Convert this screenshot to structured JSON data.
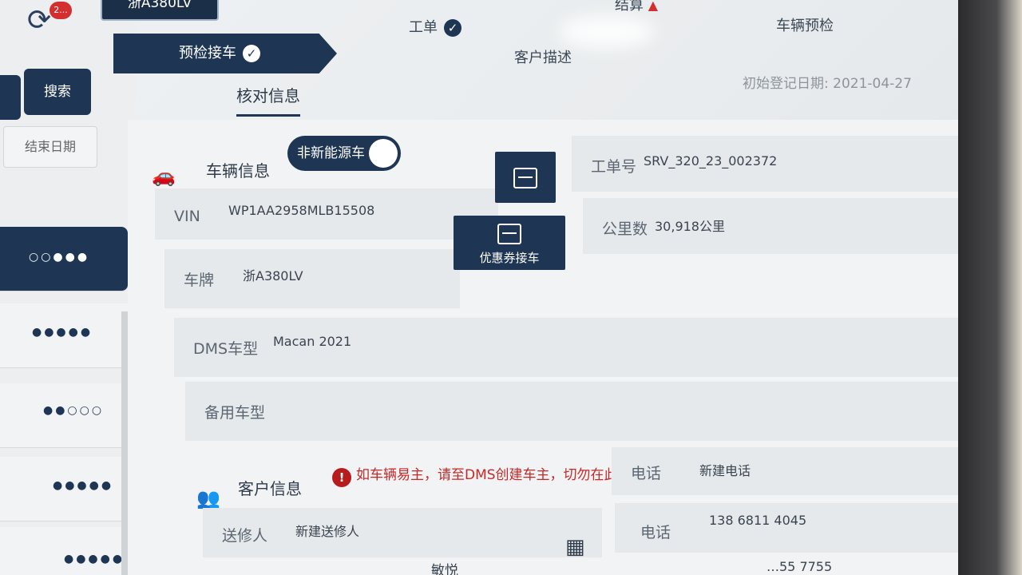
{
  "left_panel": {
    "sync_badge": "2...",
    "search_label": "搜索",
    "end_date_label": "结束日期",
    "rows": [
      {
        "dots": "○○●●●"
      },
      {
        "dots": "●●●●●"
      },
      {
        "dots": "●●○○○"
      },
      {
        "dots": "●●●●●"
      },
      {
        "dots": "●●●●●"
      }
    ]
  },
  "header": {
    "plate": "浙A380LV"
  },
  "steps": [
    {
      "label": "预检接车",
      "done": true
    },
    {
      "label": "工单",
      "done": true
    },
    {
      "label": "结算",
      "warning": true
    },
    {
      "label": "客户描述"
    },
    {
      "label": "车辆预检"
    }
  ],
  "subtab": {
    "label": "核对信息"
  },
  "registration": {
    "label": "初始登记日期:",
    "value": "2021-04-27"
  },
  "vehicle": {
    "section_title": "车辆信息",
    "energy_toggle": "非新能源车",
    "vin_label": "VIN",
    "vin_value": "WP1AA2958MLB15508",
    "plate_label": "车牌",
    "plate_value": "浙A380LV",
    "dms_label": "DMS车型",
    "dms_value": "Macan 2021",
    "backup_label": "备用车型",
    "coupon_button": "优惠券接车",
    "order_label": "工单号",
    "order_value": "SRV_320_23_002372",
    "mileage_label": "公里数",
    "mileage_value": "30,918公里"
  },
  "customer": {
    "section_title": "客户信息",
    "warning": "如车辆易主，请至DMS创建车主，切勿在此直接更新车主信息",
    "phone_label": "电话",
    "phone_placeholder": "新建电话",
    "sender_label": "送修人",
    "sender_placeholder": "新建送修人",
    "phone2_label": "电话",
    "phone2_value": "138 6811 4045",
    "partial_name": "敏悦",
    "partial_phone": "…55 7755"
  },
  "colors": {
    "primary": "#1e3553",
    "warning": "#c62828"
  }
}
